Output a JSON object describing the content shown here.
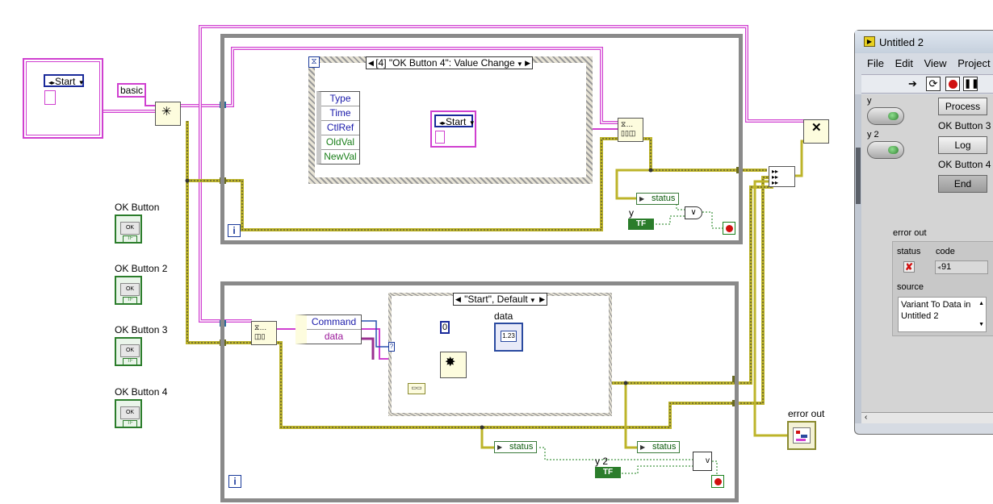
{
  "colors": {
    "string_wire": "#d040d0",
    "error_wire": "#bdb42a",
    "bool_wire": "#1a7f1a",
    "loop_frame": "#8a8a8a"
  },
  "diagram": {
    "cluster_start_label": "Start",
    "basic_const": "basic",
    "event_selector": "[4] \"OK Button 4\": Value Change",
    "event_data_nodes": [
      "Type",
      "Time",
      "CtlRef",
      "OldVal",
      "NewVal"
    ],
    "event_start_label": "Start",
    "case_selector": "\"Start\", Default",
    "unbundle_items": [
      "Command",
      "data"
    ],
    "zero_const": "0",
    "data_indicator_label": "data",
    "data_indicator_value": "1.23",
    "status_label": "status",
    "y_label": "y",
    "y2_label": "y 2",
    "tf_label": "TF",
    "error_out_label": "error out",
    "ok_buttons": [
      "OK Button",
      "OK Button 2",
      "OK Button 3",
      "OK Button 4"
    ],
    "ok_text": "OK"
  },
  "window": {
    "title": "Untitled 2",
    "menu": [
      "File",
      "Edit",
      "View",
      "Project"
    ],
    "y_label": "y",
    "y2_label": "y 2",
    "process_btn": "Process",
    "ok3_label": "OK Button 3",
    "log_btn": "Log",
    "ok4_label": "OK Button 4",
    "end_btn": "End",
    "error_cluster_label": "error out",
    "status_label": "status",
    "code_label": "code",
    "code_value": "91",
    "source_label": "source",
    "source_value": "Variant To Data in Untitled 2"
  }
}
